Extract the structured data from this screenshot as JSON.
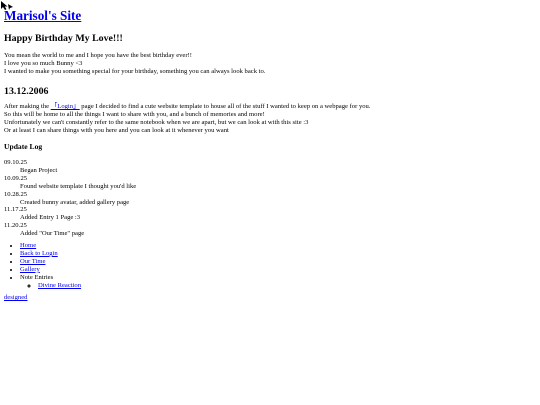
{
  "header": {
    "site_title": "Marisol's Site"
  },
  "post": {
    "title": "Happy Birthday My Love!!!",
    "intro": [
      "You mean the world to me and I hope you have the best birthday ever!!",
      "I love you so much Bunny <3",
      "I wanted to make you something special for your birthday, something you can always look back to."
    ]
  },
  "story": {
    "date": "13.12.2006",
    "line1_before": "After making the ",
    "login_link": "「Login」",
    "line1_after": " page I decided to find a cute website template to house all of the stuff I wanted to keep on a webpage for you.",
    "lines": [
      "So this will be home to all the things I want to share with you, and a bunch of memories and more!",
      "Unfortunately we can't constantly refer to the same notebook when we are apart, but we can look at with this site :3",
      "Or at least I can share things with you here and you can look at it whenever you want"
    ]
  },
  "update_log": {
    "title": "Update Log",
    "entries": [
      {
        "date": "09.10.25",
        "text": "Began Project"
      },
      {
        "date": "10.09.25",
        "text": "Found website template I thought you'd like"
      },
      {
        "date": "10.28.25",
        "text": "Created bunny avatar, added gallery page"
      },
      {
        "date": "11.17.25",
        "text": "Added Entry 1 Page :3"
      },
      {
        "date": "11.20.25",
        "text": "Added \"Our Time\" page"
      }
    ]
  },
  "nav": {
    "home": "Home",
    "back_to_login": "Back to Login",
    "our_time": "Our Time",
    "gallery": "Gallery",
    "note_entries": "Note Entries",
    "divine_reaction": "Divine Reaction"
  },
  "footer": {
    "credit_link": "designed"
  },
  "colors": {
    "link": "#0000ee",
    "text": "#000000",
    "background": "#ffffff"
  },
  "icons": {
    "cursor": "mouse-pointer-icon"
  }
}
